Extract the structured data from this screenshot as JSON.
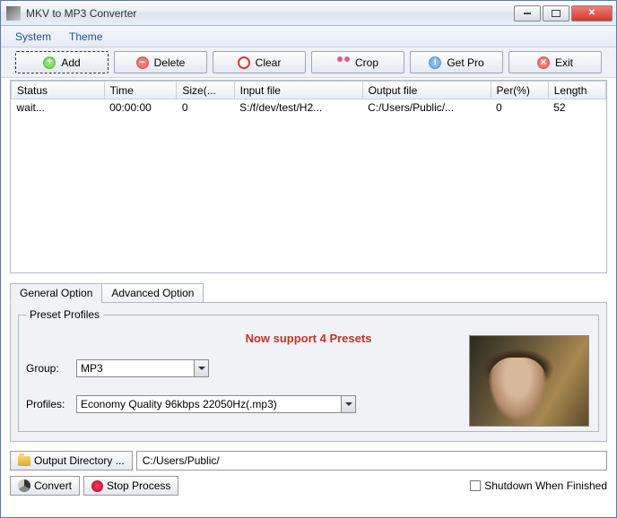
{
  "window": {
    "title": "MKV to MP3 Converter"
  },
  "menu": {
    "system": "System",
    "theme": "Theme"
  },
  "toolbar": {
    "add": "Add",
    "delete": "Delete",
    "clear": "Clear",
    "crop": "Crop",
    "getpro": "Get Pro",
    "exit": "Exit"
  },
  "table": {
    "headers": {
      "status": "Status",
      "time": "Time",
      "size": "Size(...",
      "input": "Input file",
      "output": "Output file",
      "per": "Per(%)",
      "length": "Length"
    },
    "rows": [
      {
        "status": "wait...",
        "time": "00:00:00",
        "size": "0",
        "input": "S:/f/dev/test/H2...",
        "output": "C:/Users/Public/...",
        "per": "0",
        "length": "52"
      }
    ]
  },
  "tabs": {
    "general": "General Option",
    "advanced": "Advanced Option"
  },
  "preset": {
    "legend": "Preset Profiles",
    "message": "Now support 4 Presets",
    "group_label": "Group:",
    "group_value": "MP3",
    "profiles_label": "Profiles:",
    "profiles_value": "Economy Quality 96kbps 22050Hz(.mp3)"
  },
  "output": {
    "button": "Output Directory ...",
    "path": "C:/Users/Public/"
  },
  "actions": {
    "convert": "Convert",
    "stop": "Stop Process",
    "shutdown": "Shutdown When Finished"
  }
}
